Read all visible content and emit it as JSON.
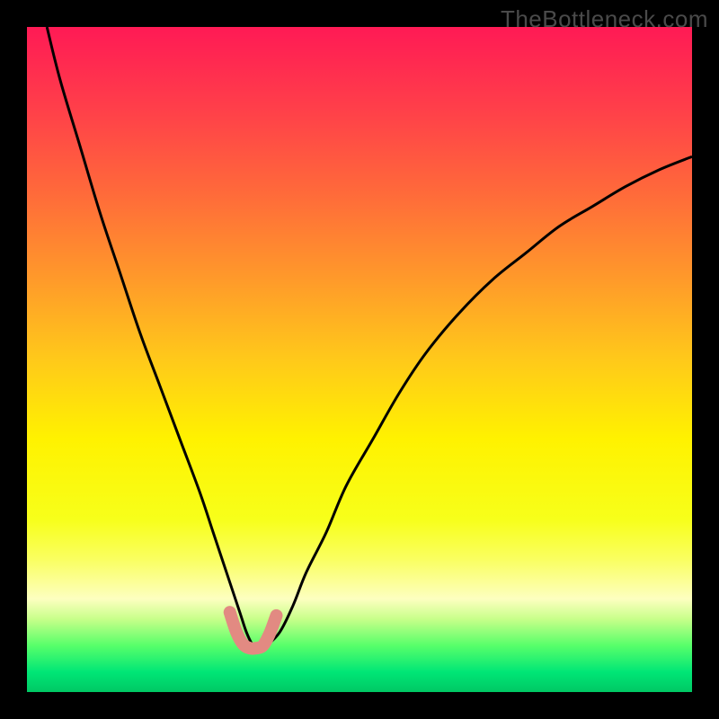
{
  "watermark": "TheBottleneck.com",
  "chart_data": {
    "type": "line",
    "title": "",
    "xlabel": "",
    "ylabel": "",
    "xlim": [
      0,
      100
    ],
    "ylim": [
      0,
      100
    ],
    "grid": false,
    "legend": false,
    "background_gradient": {
      "stops": [
        {
          "offset": 0.0,
          "color": "#ff1a55"
        },
        {
          "offset": 0.12,
          "color": "#ff3e4a"
        },
        {
          "offset": 0.25,
          "color": "#ff6a3a"
        },
        {
          "offset": 0.38,
          "color": "#ff9a2a"
        },
        {
          "offset": 0.5,
          "color": "#ffc91a"
        },
        {
          "offset": 0.62,
          "color": "#fff200"
        },
        {
          "offset": 0.74,
          "color": "#f7ff1a"
        },
        {
          "offset": 0.8,
          "color": "#faff60"
        },
        {
          "offset": 0.86,
          "color": "#fdffc0"
        },
        {
          "offset": 0.89,
          "color": "#c8ff8a"
        },
        {
          "offset": 0.93,
          "color": "#58ff6a"
        },
        {
          "offset": 0.97,
          "color": "#00e676"
        },
        {
          "offset": 1.0,
          "color": "#00c864"
        }
      ]
    },
    "series": [
      {
        "name": "bottleneck-curve",
        "stroke": "#000000",
        "stroke_width": 3,
        "x": [
          3,
          5,
          8,
          11,
          14,
          17,
          20,
          23,
          26,
          28,
          30,
          32,
          33,
          34,
          35,
          36,
          38,
          40,
          42,
          45,
          48,
          52,
          56,
          60,
          65,
          70,
          75,
          80,
          85,
          90,
          95,
          100
        ],
        "y": [
          100,
          92,
          82,
          72,
          63,
          54,
          46,
          38,
          30,
          24,
          18,
          12,
          9,
          7,
          6.5,
          7,
          9,
          13,
          18,
          24,
          31,
          38,
          45,
          51,
          57,
          62,
          66,
          70,
          73,
          76,
          78.5,
          80.5
        ]
      },
      {
        "name": "highlight-region",
        "stroke": "#e28a82",
        "stroke_width": 14,
        "linecap": "round",
        "x": [
          30.5,
          31.5,
          32.5,
          33.5,
          34.5,
          35.5,
          36.5,
          37.5
        ],
        "y": [
          12,
          9,
          7.2,
          6.6,
          6.6,
          7,
          8.8,
          11.5
        ]
      }
    ],
    "annotations": []
  }
}
